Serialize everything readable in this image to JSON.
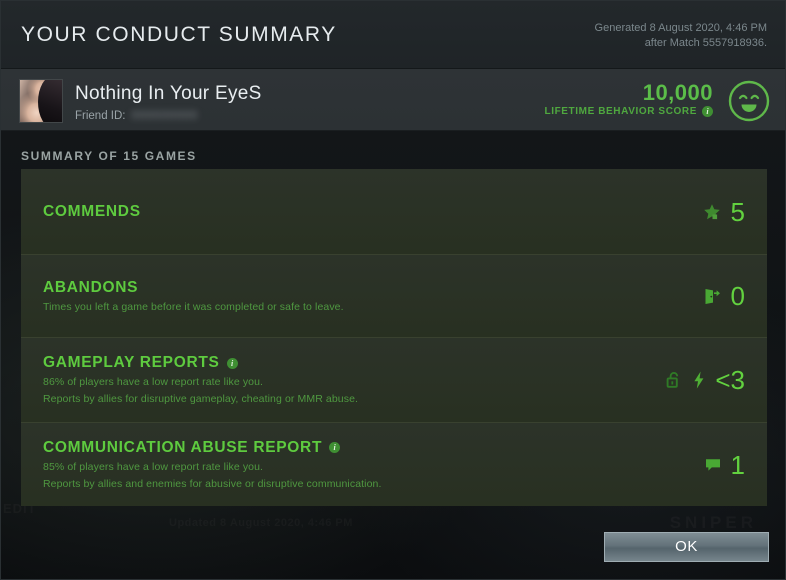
{
  "header": {
    "title": "YOUR CONDUCT SUMMARY",
    "generated_line1": "Generated 8 August 2020, 4:46 PM",
    "generated_line2": "after Match 5557918936."
  },
  "player": {
    "name": "Nothing In Your EyeS",
    "friend_id_label": "Friend ID:",
    "friend_id_value": "000000000",
    "avatar_icon": "player-avatar-photo",
    "score_value": "10,000",
    "score_label": "LIFETIME BEHAVIOR SCORE",
    "score_info_icon": "info-icon",
    "mood_icon": "smiley-happy-icon",
    "accent_green": "#5bbd49"
  },
  "summary": {
    "label": "SUMMARY OF 15 GAMES",
    "rows": [
      {
        "key": "commends",
        "title": "COMMENDS",
        "desc1": "",
        "desc2": "",
        "value": "5",
        "icon": "star-icon",
        "has_info": false
      },
      {
        "key": "abandons",
        "title": "ABANDONS",
        "desc1": "Times you left a game before it was completed or safe to leave.",
        "desc2": "",
        "value": "0",
        "icon": "door-exit-icon",
        "has_info": false
      },
      {
        "key": "gameplay_reports",
        "title": "GAMEPLAY REPORTS",
        "desc1": "86% of players have a low report rate like you.",
        "desc2": "Reports by allies for disruptive gameplay, cheating or MMR abuse.",
        "value": "<3",
        "icon": "lock-open-icon",
        "icon2": "lightning-bolt-icon",
        "has_info": true
      },
      {
        "key": "communication_abuse_report",
        "title": "COMMUNICATION ABUSE REPORT",
        "desc1": "85% of players have a low report rate like you.",
        "desc2": "Reports by allies and enemies for abusive or disruptive communication.",
        "value": "1",
        "icon": "speech-bubble-icon",
        "has_info": true
      }
    ]
  },
  "footer": {
    "ok_label": "OK"
  },
  "background_ghost": {
    "name": "Nothing In Your EyeS",
    "hero": "SNIPER",
    "updated": "Updated 8 August 2020, 4:46 PM",
    "edit": "EDIT"
  }
}
